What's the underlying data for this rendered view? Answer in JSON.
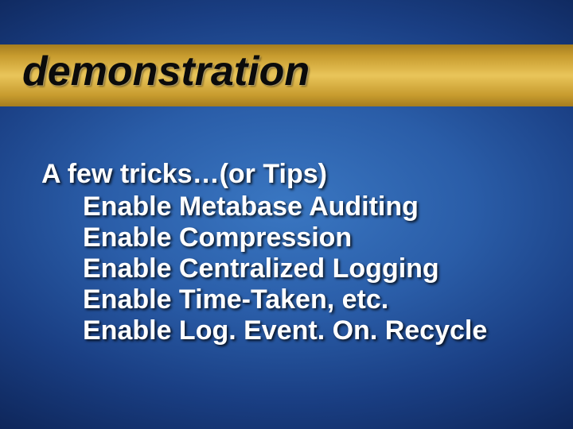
{
  "title": "demonstration",
  "body": {
    "heading": "A few tricks…(or Tips)",
    "items": [
      "Enable Metabase Auditing",
      "Enable Compression",
      "Enable Centralized Logging",
      "Enable Time-Taken, etc.",
      "Enable Log. Event. On. Recycle"
    ]
  }
}
